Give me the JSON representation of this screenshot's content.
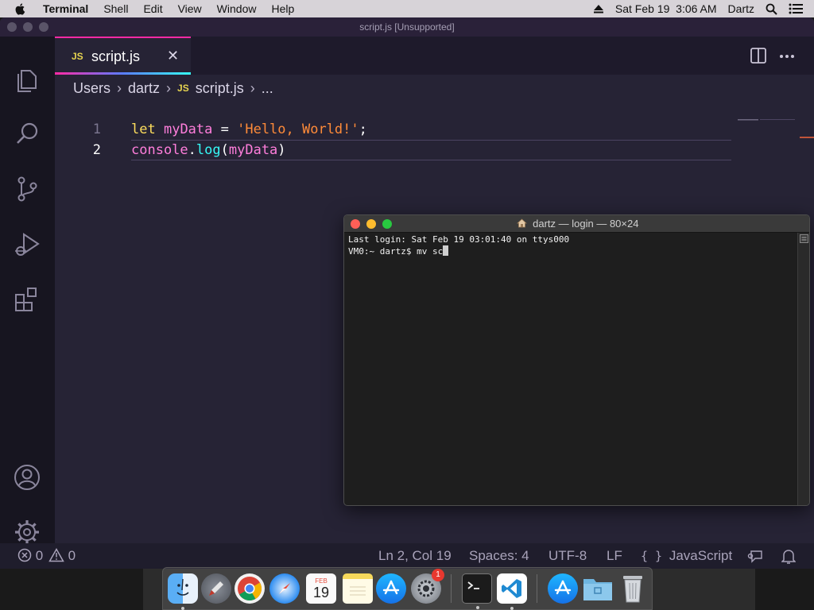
{
  "menubar": {
    "app_name": "Terminal",
    "items": [
      "Shell",
      "Edit",
      "View",
      "Window",
      "Help"
    ],
    "datetime": "Sat Feb 19  3:06 AM",
    "user": "Dartz"
  },
  "vscode": {
    "window_title": "script.js [Unsupported]",
    "tab": {
      "icon_label": "JS",
      "name": "script.js"
    },
    "breadcrumb": [
      "Users",
      "dartz",
      "script.js",
      "..."
    ],
    "breadcrumb_icon_label": "JS",
    "code_lines": [
      {
        "num": "1",
        "tokens": [
          {
            "t": "let",
            "c": "kw"
          },
          {
            "t": " ",
            "c": "op"
          },
          {
            "t": "myData",
            "c": "var"
          },
          {
            "t": " = ",
            "c": "op"
          },
          {
            "t": "'Hello, World!'",
            "c": "str"
          },
          {
            "t": ";",
            "c": "op"
          }
        ]
      },
      {
        "num": "2",
        "tokens": [
          {
            "t": "console",
            "c": "var"
          },
          {
            "t": ".",
            "c": "op"
          },
          {
            "t": "log",
            "c": "fn"
          },
          {
            "t": "(",
            "c": "op"
          },
          {
            "t": "myData",
            "c": "var"
          },
          {
            "t": ")",
            "c": "op"
          }
        ]
      }
    ],
    "active_line": 2,
    "status": {
      "errors": "0",
      "warnings": "0",
      "position": "Ln 2, Col 19",
      "spaces": "Spaces: 4",
      "encoding": "UTF-8",
      "eol": "LF",
      "language": "JavaScript"
    },
    "colors": {
      "accent": "#ff2aa5",
      "background": "#262335",
      "activity_bar": "#171520"
    }
  },
  "terminal": {
    "title": "dartz — login — 80×24",
    "lines": [
      "Last login: Sat Feb 19 03:01:40 on ttys000",
      "VM0:~ dartz$ mv sc"
    ]
  },
  "dock": {
    "items": [
      {
        "name": "finder",
        "running": true
      },
      {
        "name": "launchpad",
        "running": false
      },
      {
        "name": "chrome",
        "running": false
      },
      {
        "name": "safari",
        "running": false
      },
      {
        "name": "calendar",
        "running": false,
        "label": "FEB",
        "day": "19"
      },
      {
        "name": "notes",
        "running": false
      },
      {
        "name": "app-store",
        "running": false
      },
      {
        "name": "system-preferences",
        "running": false,
        "badge": "1"
      },
      {
        "name": "terminal",
        "running": true
      },
      {
        "name": "vscode",
        "running": true
      },
      {
        "name": "app-store-2",
        "running": false
      },
      {
        "name": "downloads-folder",
        "running": false
      },
      {
        "name": "trash",
        "running": false
      }
    ]
  }
}
